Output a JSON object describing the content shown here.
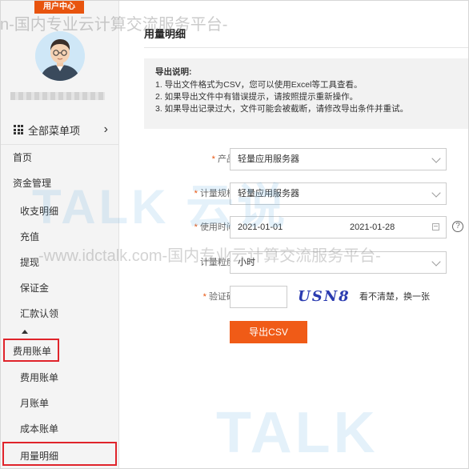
{
  "watermark": {
    "top_text": "n-国内专业云计算交流服务平台-",
    "mid_text": "-www.idctalk.com-国内专业云计算交流服务平台-",
    "logo_text": "TALK 云说",
    "logo_text_2": "TALK"
  },
  "sidebar": {
    "header": "用户中心",
    "all_menu": "全部菜单项",
    "items": [
      {
        "label": "首页",
        "level": 1
      },
      {
        "label": "资金管理",
        "level": 1
      },
      {
        "label": "收支明细",
        "level": 2
      },
      {
        "label": "充值",
        "level": 2
      },
      {
        "label": "提现",
        "level": 2
      },
      {
        "label": "保证金",
        "level": 2
      },
      {
        "label": "汇款认领",
        "level": 2
      },
      {
        "label": "费用账单",
        "level": 1,
        "highlighted": true
      },
      {
        "label": "费用账单",
        "level": 2
      },
      {
        "label": "月账单",
        "level": 2
      },
      {
        "label": "成本账单",
        "level": 2
      },
      {
        "label": "用量明细",
        "level": 2,
        "highlighted": true,
        "active": true
      }
    ]
  },
  "main": {
    "title": "用量明细",
    "notice": {
      "title": "导出说明:",
      "lines": [
        "1. 导出文件格式为CSV，您可以使用Excel等工具查看。",
        "2. 如果导出文件中有错误提示，请按照提示重新操作。",
        "3. 如果导出记录过大，文件可能会被截断，请修改导出条件并重试。"
      ]
    },
    "form": {
      "product_label": "产品:",
      "product_value": "轻量应用服务器",
      "spec_label": "计量规格:",
      "spec_value": "轻量应用服务器",
      "time_label": "使用时间:",
      "start_date": "2021-01-01",
      "end_date": "2021-01-28",
      "help": "?",
      "granularity_label": "计量粒度:",
      "granularity_value": "小时",
      "captcha_label": "验证码:",
      "captcha_image_text": "USN8",
      "captcha_refresh": "看不清楚，换一张"
    },
    "export_button": "导出CSV"
  },
  "colors": {
    "accent": "#f05b17",
    "highlight_box": "#e0242b",
    "required_star": "#e8540e"
  }
}
